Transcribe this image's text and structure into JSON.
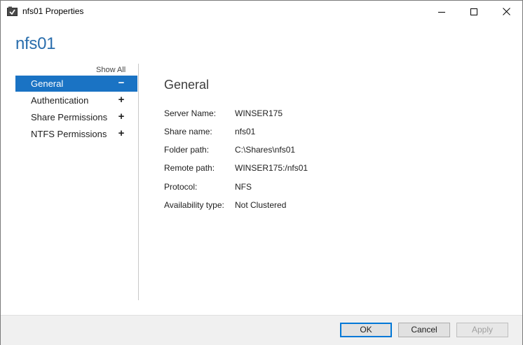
{
  "window": {
    "title": "nfs01 Properties",
    "icon": "share-properties-icon"
  },
  "header": {
    "share_name": "nfs01"
  },
  "nav": {
    "show_all": "Show All",
    "items": [
      {
        "label": "General",
        "sign": "−",
        "selected": true
      },
      {
        "label": "Authentication",
        "sign": "+",
        "selected": false
      },
      {
        "label": "Share Permissions",
        "sign": "+",
        "selected": false
      },
      {
        "label": "NTFS Permissions",
        "sign": "+",
        "selected": false
      }
    ]
  },
  "general": {
    "title": "General",
    "properties": [
      {
        "label": "Server Name:",
        "value": "WINSER175"
      },
      {
        "label": "Share name:",
        "value": "nfs01"
      },
      {
        "label": "Folder path:",
        "value": "C:\\Shares\\nfs01"
      },
      {
        "label": "Remote path:",
        "value": "WINSER175:/nfs01"
      },
      {
        "label": "Protocol:",
        "value": "NFS"
      },
      {
        "label": "Availability type:",
        "value": "Not Clustered"
      }
    ]
  },
  "buttons": {
    "ok": "OK",
    "cancel": "Cancel",
    "apply": "Apply",
    "apply_enabled": false
  },
  "colors": {
    "accent": "#1a73c4",
    "heading": "#2a6ead"
  }
}
